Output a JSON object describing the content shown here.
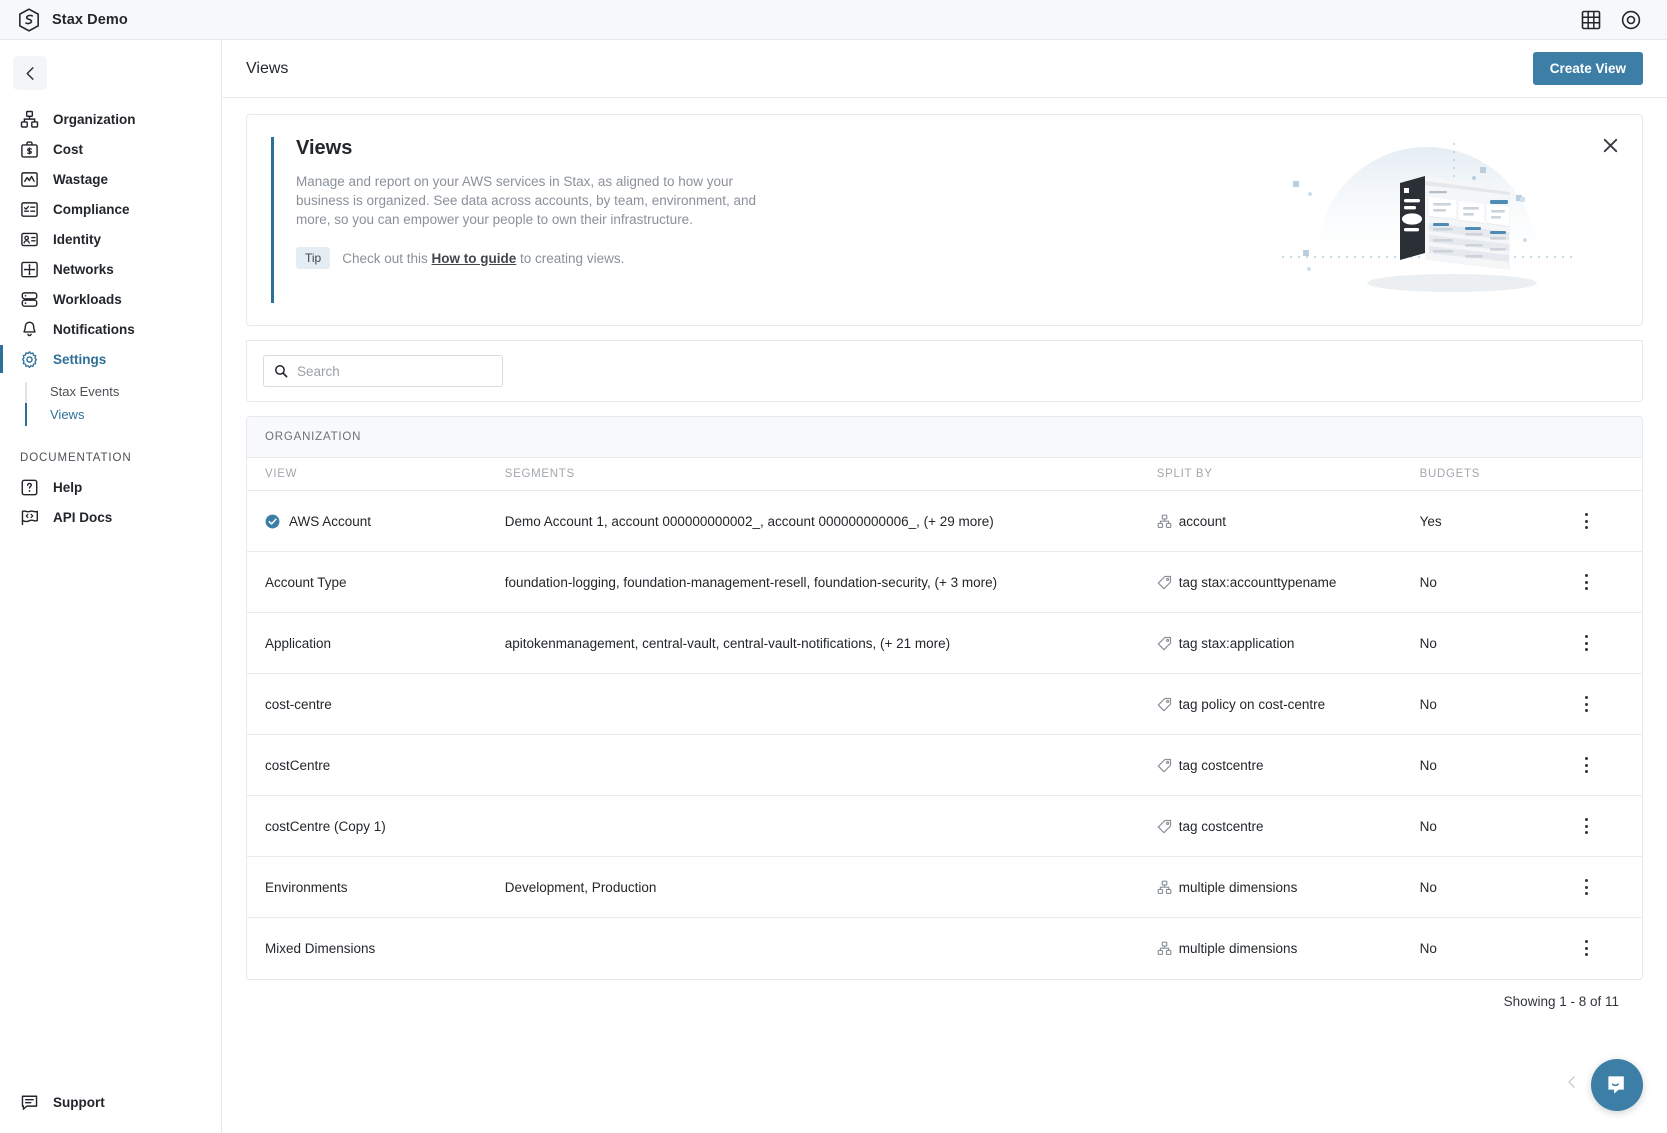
{
  "topbar": {
    "brand": "Stax Demo",
    "logo_icon": "stax-hexagon-logo",
    "icons": [
      {
        "name": "grid-apps-icon",
        "glyph": "grid"
      },
      {
        "name": "account-circle-icon",
        "glyph": "account"
      }
    ]
  },
  "sidebar": {
    "collapse_icon": "chevron-left-icon",
    "items": [
      {
        "label": "Organization",
        "icon": "organization-icon",
        "active": false
      },
      {
        "label": "Cost",
        "icon": "cost-briefcase-icon",
        "active": false
      },
      {
        "label": "Wastage",
        "icon": "wastage-chart-icon",
        "active": false
      },
      {
        "label": "Compliance",
        "icon": "compliance-checklist-icon",
        "active": false
      },
      {
        "label": "Identity",
        "icon": "identity-card-icon",
        "active": false
      },
      {
        "label": "Networks",
        "icon": "networks-icon",
        "active": false
      },
      {
        "label": "Workloads",
        "icon": "workloads-server-icon",
        "active": false
      },
      {
        "label": "Notifications",
        "icon": "bell-icon",
        "active": false
      },
      {
        "label": "Settings",
        "icon": "gear-icon",
        "active": true
      }
    ],
    "subitems": [
      {
        "label": "Stax Events",
        "active": false
      },
      {
        "label": "Views",
        "active": true
      }
    ],
    "section_label": "DOCUMENTATION",
    "doc_items": [
      {
        "label": "Help",
        "icon": "help-question-icon"
      },
      {
        "label": "API Docs",
        "icon": "api-docs-code-icon"
      }
    ],
    "support": {
      "label": "Support",
      "icon": "support-chat-icon"
    }
  },
  "header": {
    "title": "Views",
    "create_button": "Create View"
  },
  "banner": {
    "title": "Views",
    "description": "Manage and report on your AWS services in Stax, as aligned to how your business is organized. See data across accounts, by team, environment, and more, so you can empower your people to own their infrastructure.",
    "tip_chip": "Tip",
    "tip_prefix": "Check out this ",
    "tip_link": "How to guide",
    "tip_suffix": " to creating views.",
    "close_icon": "close-icon",
    "illustration": "dashboard-illustration"
  },
  "search": {
    "placeholder": "Search",
    "value": "",
    "icon": "search-icon"
  },
  "table": {
    "group_header": "ORGANIZATION",
    "columns": [
      "VIEW",
      "SEGMENTS",
      "SPLIT BY",
      "BUDGETS"
    ],
    "rows": [
      {
        "view": "AWS Account",
        "badge": "verified-check-badge",
        "segments": "Demo Account 1, account 000000000002_, account 000000000006_, (+ 29 more)",
        "split_icon": "dimension-icon",
        "split_by": "account",
        "budgets": "Yes"
      },
      {
        "view": "Account Type",
        "badge": null,
        "segments": "foundation-logging, foundation-management-resell, foundation-security, (+ 3 more)",
        "split_icon": "tag-icon",
        "split_by": "tag stax:accounttypename",
        "budgets": "No"
      },
      {
        "view": "Application",
        "badge": null,
        "segments": "apitokenmanagement, central-vault, central-vault-notifications, (+ 21 more)",
        "split_icon": "tag-icon",
        "split_by": "tag stax:application",
        "budgets": "No"
      },
      {
        "view": "cost-centre",
        "badge": null,
        "segments": "",
        "split_icon": "tag-icon",
        "split_by": "tag policy on cost-centre",
        "budgets": "No"
      },
      {
        "view": "costCentre",
        "badge": null,
        "segments": "",
        "split_icon": "tag-icon",
        "split_by": "tag costcentre",
        "budgets": "No"
      },
      {
        "view": "costCentre (Copy 1)",
        "badge": null,
        "segments": "",
        "split_icon": "tag-icon",
        "split_by": "tag costcentre",
        "budgets": "No"
      },
      {
        "view": "Environments",
        "badge": null,
        "segments": "Development, Production",
        "split_icon": "dimension-icon",
        "split_by": "multiple dimensions",
        "budgets": "No"
      },
      {
        "view": "Mixed Dimensions",
        "badge": null,
        "segments": "",
        "split_icon": "dimension-icon",
        "split_by": "multiple dimensions",
        "budgets": "No"
      }
    ],
    "row_menu_icon": "kebab-menu-icon",
    "pagination": "Showing 1 - 8 of 11"
  },
  "chat": {
    "fab_icon": "chat-bubble-icon",
    "chevron_icon": "chevron-left-icon"
  },
  "colors": {
    "accent": "#3c7ea6",
    "accent_dark": "#2e7099",
    "topbar_bg": "#f7f8fa",
    "border": "#e6e9ed",
    "muted_text": "#8a9199"
  }
}
